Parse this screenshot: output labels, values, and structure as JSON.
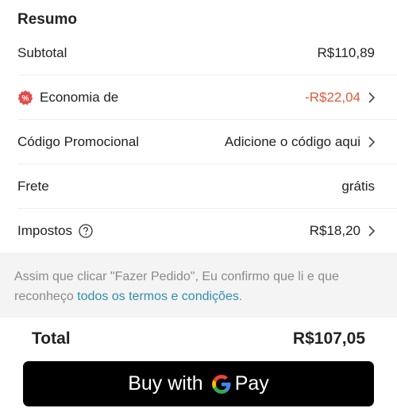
{
  "summary": {
    "title": "Resumo",
    "subtotal": {
      "label": "Subtotal",
      "value": "R$110,89"
    },
    "savings": {
      "label": "Economia de",
      "value": "-R$22,04"
    },
    "promo": {
      "label": "Código Promocional",
      "value": "Adicione o código aqui"
    },
    "shipping": {
      "label": "Frete",
      "value": "grátis"
    },
    "taxes": {
      "label": "Impostos",
      "value": "R$18,20"
    }
  },
  "notice": {
    "text": "Assim que clicar \"Fazer Pedido\", Eu confirmo que li e que reconheço ",
    "link": "todos os termos e condições",
    "suffix": "."
  },
  "total": {
    "label": "Total",
    "value": "R$107,05"
  },
  "pay_button": {
    "prefix": "Buy with",
    "suffix": "Pay"
  },
  "colors": {
    "discount": "#e05a3c",
    "link": "#2f8fb0",
    "button_bg": "#000000"
  },
  "icons": [
    "percent-badge-icon",
    "chevron-right-icon",
    "help-circle-icon",
    "google-g-icon"
  ]
}
